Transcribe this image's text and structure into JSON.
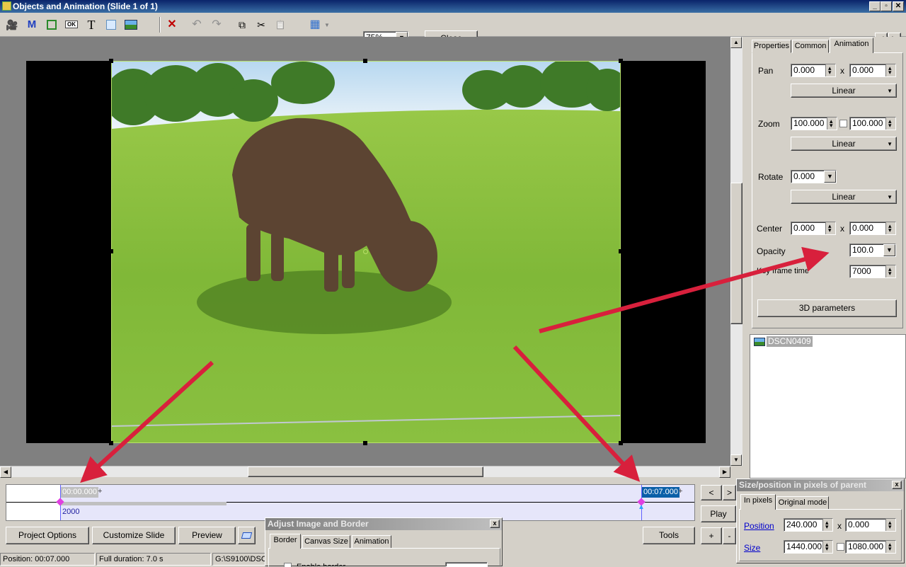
{
  "window": {
    "title": "Objects and Animation  (Slide 1 of 1)"
  },
  "toolbar": {
    "zoom_value": "75%",
    "close_label": "Close",
    "icons": [
      "camera-icon",
      "mask-icon",
      "frame-icon",
      "ok-button-icon",
      "text-icon",
      "rectangle-icon",
      "image-icon",
      "delete-icon",
      "undo-icon",
      "redo-icon",
      "copy-icon",
      "cut-icon",
      "paste-icon",
      "grid-icon"
    ],
    "glyphs": {
      "mask": "M",
      "ok": "OK",
      "text": "T",
      "delete": "✕",
      "undo": "↶",
      "redo": "↷",
      "copy": "⧉",
      "cut": "✂",
      "paste": "📋",
      "grid": "▦",
      "camera": "🎥"
    }
  },
  "tabs": {
    "properties": "Properties",
    "common": "Common",
    "animation": "Animation"
  },
  "animation": {
    "pan_label": "Pan",
    "pan_x": "0.000",
    "pan_y": "0.000",
    "pan_mode": "Linear",
    "zoom_label": "Zoom",
    "zoom_x": "100.000",
    "zoom_y": "100.000",
    "zoom_mode": "Linear",
    "rotate_label": "Rotate",
    "rotate_value": "0.000",
    "rotate_mode": "Linear",
    "center_label": "Center",
    "center_x": "0.000",
    "center_y": "0.000",
    "opacity_label": "Opacity",
    "opacity_value": "100.0",
    "keyframe_label": "Key frame time",
    "keyframe_value": "7000",
    "params_3d": "3D parameters",
    "x_sep": "x"
  },
  "objects": {
    "items": [
      "DSCN0409"
    ]
  },
  "timeline": {
    "start_time": "00:00.000",
    "end_time": "00:07.000",
    "plus": "+",
    "track_value": "2000",
    "prev": "<",
    "next": ">",
    "play": "Play",
    "add": "+",
    "remove": "-"
  },
  "bottom_buttons": {
    "project_options": "Project Options",
    "customize_slide": "Customize Slide",
    "preview": "Preview",
    "tools": "Tools"
  },
  "adjust_window": {
    "title": "Adjust Image and Border",
    "tabs": [
      "Border",
      "Canvas Size",
      "Animation"
    ],
    "close": "x",
    "field_label": "Enable border"
  },
  "size_window": {
    "title": "Size/position in pixels of parent",
    "close": "x",
    "tab_pixels": "In pixels",
    "tab_original": "Original mode",
    "position_label": "Position",
    "pos_x": "240.000",
    "pos_y": "0.000",
    "size_label": "Size",
    "size_w": "1440.000",
    "size_h": "1080.000",
    "x_sep": "x"
  },
  "status": {
    "position": "Position:  00:07.000",
    "duration": "Full duration:  7.0 s",
    "path": "G:\\S9100\\DSC"
  }
}
